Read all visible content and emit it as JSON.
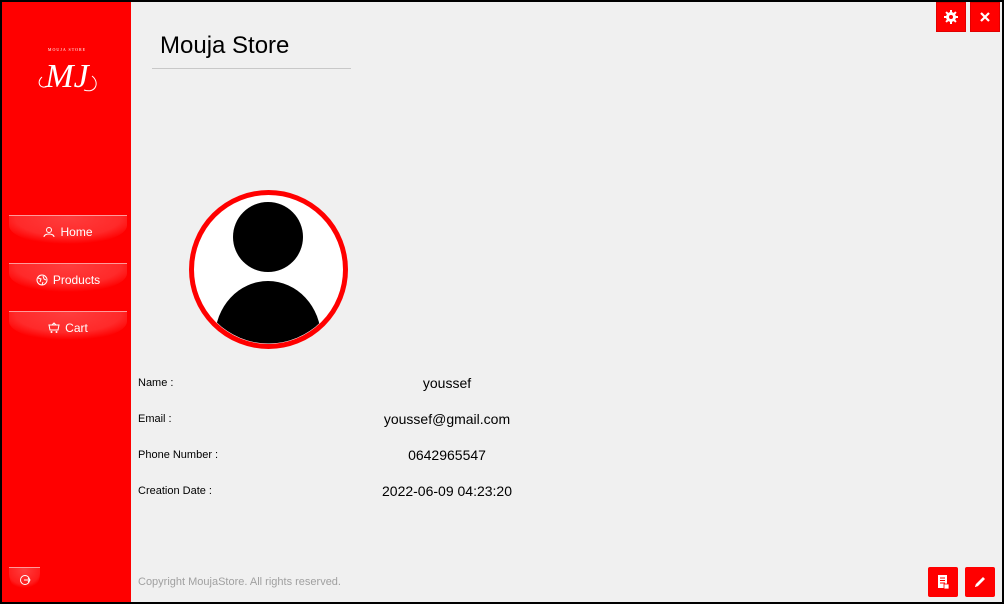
{
  "app": {
    "title": "Mouja Store",
    "logo_text": "MJ",
    "logo_subtitle": "MOUJA STORE"
  },
  "sidebar": {
    "items": [
      {
        "label": "Home",
        "icon": "user-icon"
      },
      {
        "label": "Products",
        "icon": "globe-icon"
      },
      {
        "label": "Cart",
        "icon": "cart-icon"
      }
    ],
    "logout_icon": "logout-icon"
  },
  "header": {
    "settings_icon": "gear-icon",
    "close_icon": "close-icon"
  },
  "profile": {
    "avatar_icon": "user-avatar-icon",
    "fields": [
      {
        "label": "Name :",
        "value": "youssef"
      },
      {
        "label": "Email :",
        "value": "youssef@gmail.com"
      },
      {
        "label": "Phone Number :",
        "value": "0642965547"
      },
      {
        "label": "Creation Date :",
        "value": "2022-06-09 04:23:20"
      }
    ]
  },
  "footer": {
    "copyright": "Copyright MoujaStore. All rights reserved.",
    "report_icon": "document-icon",
    "edit_icon": "pencil-icon"
  },
  "colors": {
    "accent": "#ff0000",
    "background": "#f0f0f0",
    "copyright_text": "#a0a0a0"
  }
}
